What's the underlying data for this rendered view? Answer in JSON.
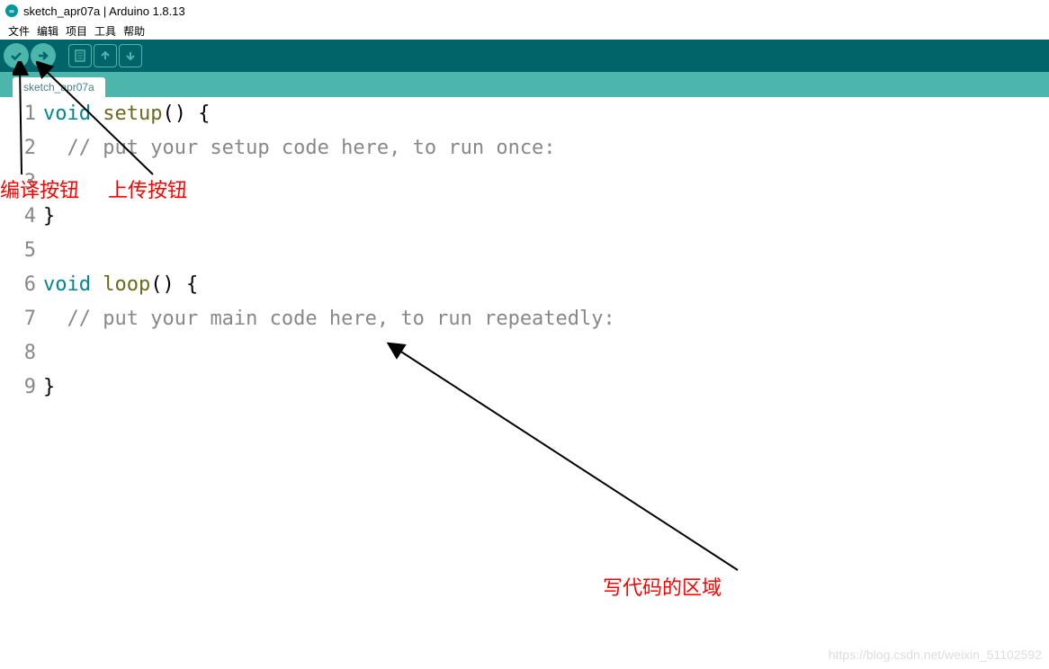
{
  "titlebar": {
    "title": "sketch_apr07a | Arduino 1.8.13"
  },
  "menubar": {
    "items": [
      "文件",
      "编辑",
      "项目",
      "工具",
      "帮助"
    ]
  },
  "toolbar": {
    "verify_name": "verify-button",
    "upload_name": "upload-button",
    "new_name": "new-button",
    "open_name": "open-button",
    "save_name": "save-button"
  },
  "tab": {
    "name": "sketch_apr07a"
  },
  "code": {
    "lines": [
      {
        "num": "1",
        "html": "<span class='kw'>void</span> <span class='fn'>setup</span>() {"
      },
      {
        "num": "2",
        "html": "  <span class='cm'>// put your setup code here, to run once:</span>"
      },
      {
        "num": "3",
        "html": ""
      },
      {
        "num": "4",
        "html": "}"
      },
      {
        "num": "5",
        "html": ""
      },
      {
        "num": "6",
        "html": "<span class='kw'>void</span> <span class='fn'>loop</span>() {"
      },
      {
        "num": "7",
        "html": "  <span class='cm'>// put your main code here, to run repeatedly:</span>"
      },
      {
        "num": "8",
        "html": ""
      },
      {
        "num": "9",
        "html": "}"
      }
    ]
  },
  "annotations": {
    "compile": "编译按钮",
    "upload": "上传按钮",
    "codearea": "写代码的区域"
  },
  "watermark": "https://blog.csdn.net/weixin_51102592"
}
